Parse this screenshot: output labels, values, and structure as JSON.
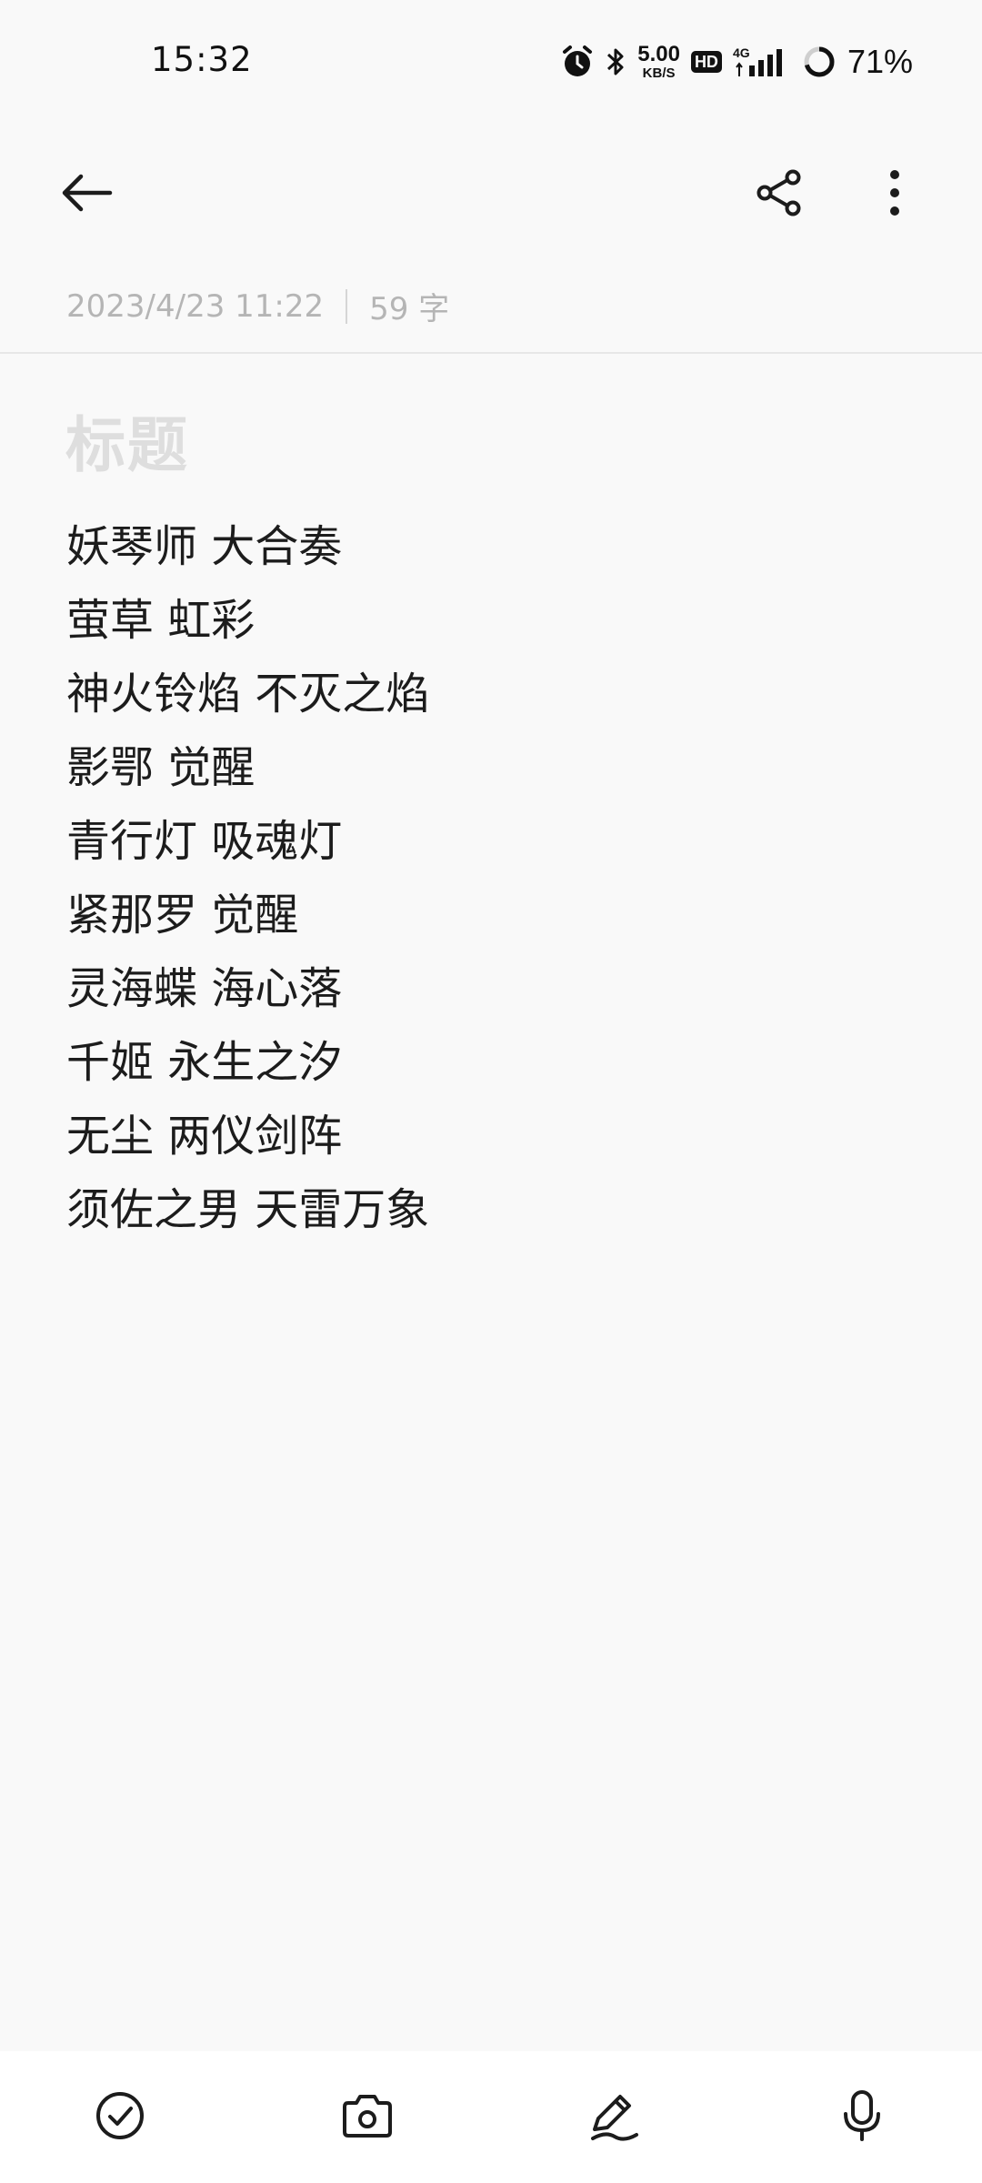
{
  "status_bar": {
    "time": "15:32",
    "net_speed_value": "5.00",
    "net_speed_unit": "KB/S",
    "hd_label": "HD",
    "network_label": "4G",
    "battery_percent": "71%",
    "battery_level": 0.71,
    "icons": [
      "alarm-icon",
      "bluetooth-icon",
      "signal-icon",
      "battery-icon"
    ]
  },
  "app_bar": {
    "icons": [
      "back-arrow-icon",
      "share-icon",
      "more-vertical-icon"
    ]
  },
  "meta": {
    "datetime": "2023/4/23 11:22",
    "word_count": "59 字"
  },
  "note": {
    "title_placeholder": "标题",
    "lines": [
      "妖琴师 大合奏",
      "萤草 虹彩",
      "神火铃焰 不灭之焰",
      "影鄂 觉醒",
      "青行灯 吸魂灯",
      "紧那罗 觉醒",
      "灵海蝶 海心落",
      "千姬 永生之汐",
      "无尘 两仪剑阵",
      "须佐之男 天雷万象"
    ]
  },
  "toolbar": {
    "icons": [
      "checklist-icon",
      "camera-icon",
      "pen-icon",
      "microphone-icon"
    ]
  },
  "colors": {
    "background": "#f9f9f9",
    "text": "#1c1c1c",
    "meta_text": "#b5b5b5",
    "placeholder": "#dedede",
    "toolbar_bg": "#ffffff"
  }
}
